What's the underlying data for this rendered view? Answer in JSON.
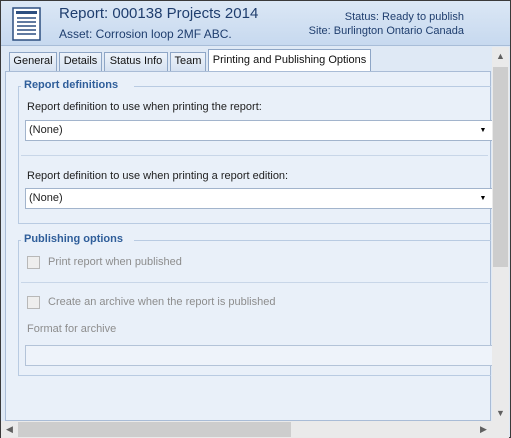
{
  "header": {
    "title": "Report: 000138 Projects 2014",
    "subtitle": "Asset: Corrosion loop 2MF ABC.",
    "status": "Status: Ready to publish",
    "site": "Site: Burlington Ontario Canada",
    "icon": "report-document-icon"
  },
  "tabs": [
    {
      "label": "General"
    },
    {
      "label": "Details"
    },
    {
      "label": "Status Info"
    },
    {
      "label": "Team"
    },
    {
      "label": "Printing and Publishing Options",
      "active": true
    }
  ],
  "report_definitions": {
    "title": "Report definitions",
    "print_label": "Report definition to use when printing the report:",
    "print_value": "(None)",
    "edition_label": "Report definition to use when printing a report edition:",
    "edition_value": "(None)"
  },
  "publishing_options": {
    "title": "Publishing options",
    "print_when_published": "Print report when published",
    "print_when_published_checked": false,
    "create_archive": "Create an archive when  the report is published",
    "create_archive_checked": false,
    "format_label": "Format for archive",
    "format_value": ""
  },
  "colors": {
    "accent": "#2f5e9a",
    "header_bg": "#c7d9ef",
    "panel_bg": "#e9f0f9"
  }
}
